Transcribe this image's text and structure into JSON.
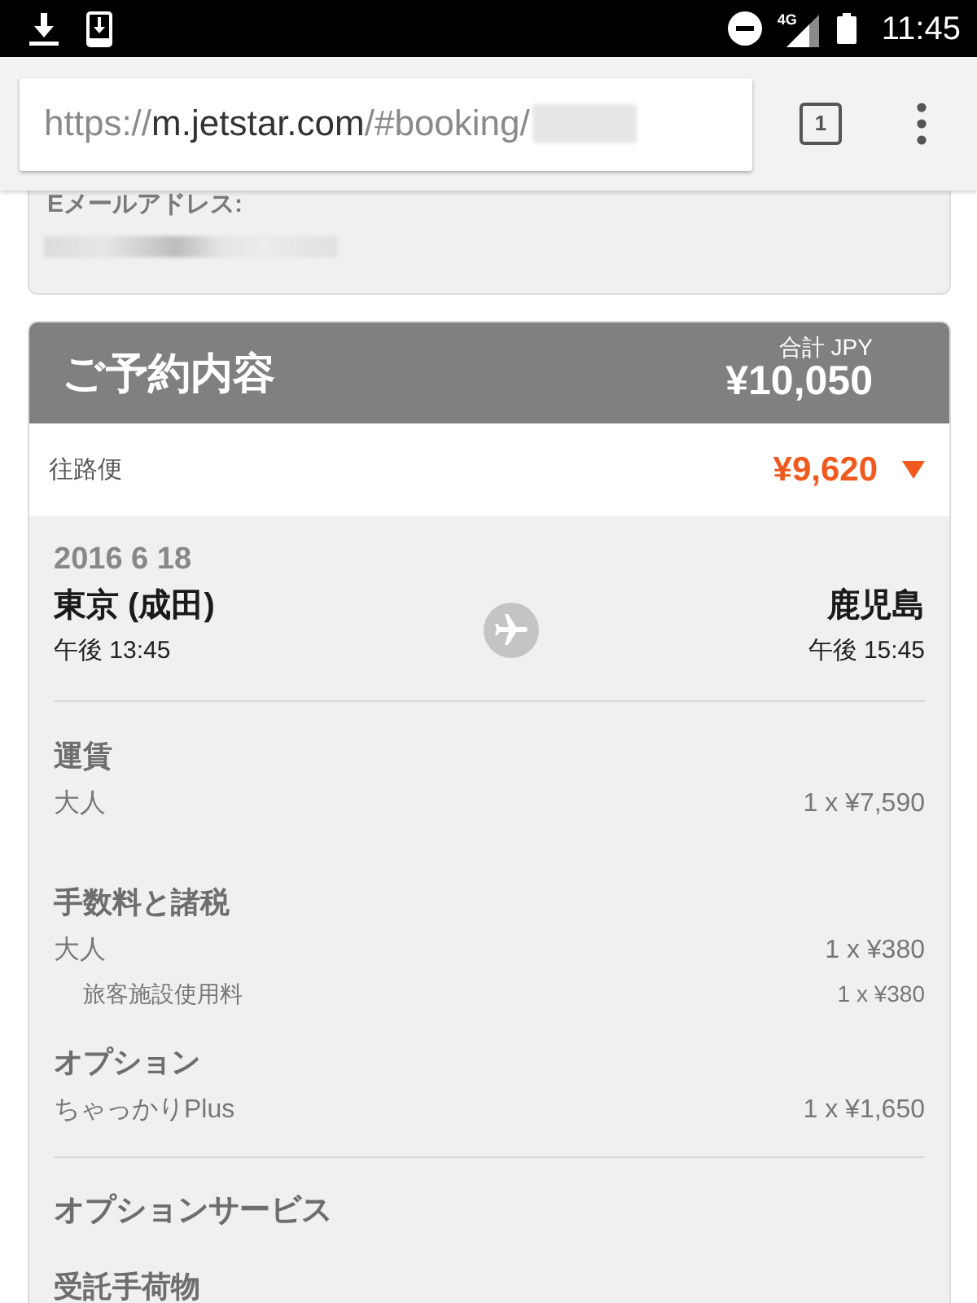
{
  "status_bar": {
    "network_type": "4G",
    "time": "11:45"
  },
  "browser": {
    "url": {
      "scheme": "https://",
      "host": "m.jetstar.com",
      "path": "/#booking/"
    },
    "tab_count": "1"
  },
  "contact_card": {
    "email_label": "Eメールアドレス:"
  },
  "booking_summary": {
    "title": "ご予約内容",
    "total_label": "合計 JPY",
    "total": "¥10,050",
    "flight": {
      "label": "往路便",
      "price": "¥9,620",
      "expanded": true,
      "date": "2016 6 18",
      "origin": {
        "city": "東京 (成田)",
        "time": "午後 13:45"
      },
      "destination": {
        "city": "鹿児島",
        "time": "午後 15:45"
      },
      "fare_groups": [
        {
          "title": "運賃",
          "items": [
            {
              "label": "大人",
              "amount": "1 x ¥7,590"
            }
          ]
        },
        {
          "title": "手数料と諸税",
          "items": [
            {
              "label": "大人",
              "amount": "1 x ¥380",
              "children": [
                {
                  "label": "旅客施設使用料",
                  "amount": "1 x ¥380"
                }
              ]
            }
          ]
        },
        {
          "title": "オプション",
          "items": [
            {
              "label": "ちゃっかりPlus",
              "amount": "1 x ¥1,650"
            }
          ]
        }
      ],
      "option_services": {
        "title": "オプションサービス",
        "groups": [
          {
            "title": "受託手荷物"
          }
        ]
      }
    }
  }
}
